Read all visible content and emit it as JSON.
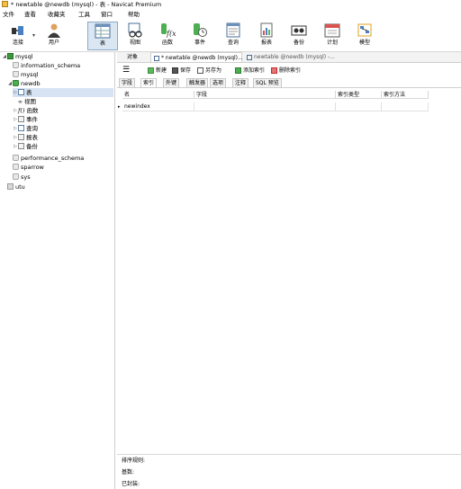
{
  "window": {
    "title": "* newtable @newdb (mysql) - 表 - Navicat Premium"
  },
  "menu": [
    "文件",
    "查看",
    "收藏夹",
    "工具",
    "窗口",
    "帮助"
  ],
  "toolbar": {
    "items": [
      {
        "label": "连接",
        "icon": "connection-icon"
      },
      {
        "label": "用户",
        "icon": "user-icon"
      },
      {
        "label": "表",
        "icon": "table-icon",
        "active": true
      },
      {
        "label": "视图",
        "icon": "view-icon"
      },
      {
        "label": "函数",
        "icon": "function-icon"
      },
      {
        "label": "事件",
        "icon": "event-icon"
      },
      {
        "label": "查询",
        "icon": "query-icon"
      },
      {
        "label": "报表",
        "icon": "report-icon"
      },
      {
        "label": "备份",
        "icon": "backup-icon"
      },
      {
        "label": "计划",
        "icon": "schedule-icon"
      },
      {
        "label": "模型",
        "icon": "model-icon"
      }
    ]
  },
  "tree": {
    "nodes": [
      {
        "label": "mysql",
        "icon": "connection-icon"
      },
      {
        "label": "information_schema",
        "icon": "database-icon"
      },
      {
        "label": "mysql",
        "icon": "database-icon"
      },
      {
        "label": "newdb",
        "icon": "database-open-icon"
      },
      {
        "label": "表",
        "icon": "table-icon"
      },
      {
        "label": "视图",
        "icon": "view-icon"
      },
      {
        "label": "函数",
        "icon": "function-icon"
      },
      {
        "label": "事件",
        "icon": "event-icon"
      },
      {
        "label": "查询",
        "icon": "query-icon"
      },
      {
        "label": "报表",
        "icon": "report-icon"
      },
      {
        "label": "备份",
        "icon": "backup-icon"
      },
      {
        "label": "performance_schema",
        "icon": "database-icon"
      },
      {
        "label": "sparrow",
        "icon": "database-icon"
      },
      {
        "label": "sys",
        "icon": "database-icon"
      },
      {
        "label": "utu",
        "icon": "connection-icon"
      }
    ]
  },
  "doc_tabs": {
    "objects": "对象",
    "active": "* newtable @newdb (mysql)...",
    "inactive": "newtable @newdb (mysql) -..."
  },
  "subtoolbar": {
    "new": "新建",
    "save": "保存",
    "save_as": "另存为",
    "add_index": "添加索引",
    "delete_index": "删除索引"
  },
  "design_tabs": [
    "字段",
    "索引",
    "外键",
    "触发器",
    "选项",
    "注释",
    "SQL 预览"
  ],
  "index_grid": {
    "columns": [
      "名",
      "字段",
      "索引类型",
      "索引方法"
    ],
    "rows": [
      {
        "name": "newindex",
        "fields": "",
        "type": "",
        "method": ""
      }
    ]
  },
  "bottom_panel": {
    "collation_label": "排序规则:",
    "cardinality_label": "基数:",
    "packed_label": "已封装:"
  },
  "colors": {
    "selection": "#d7e3f2",
    "active_toolbar": "#dbe6f3",
    "border": "#cfcfcf"
  }
}
